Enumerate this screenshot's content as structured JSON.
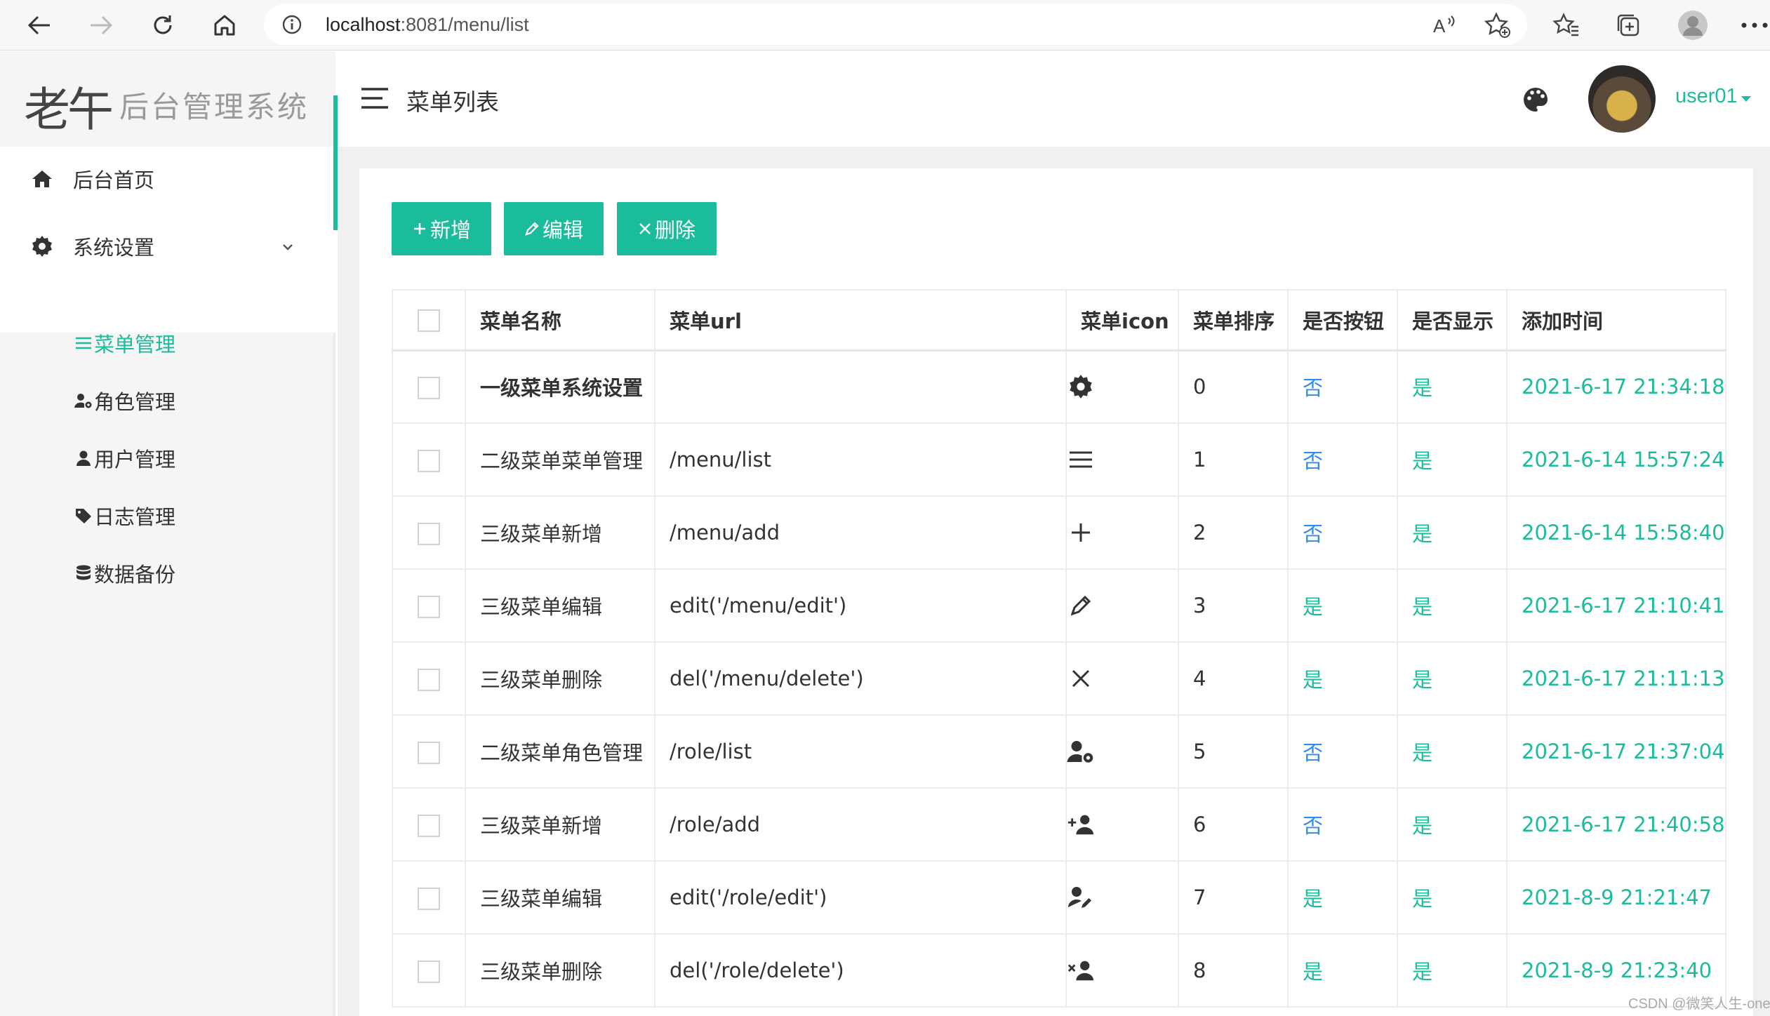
{
  "browser": {
    "url_host": "localhost",
    "url_rest": ":8081/menu/list"
  },
  "sidebar": {
    "logo_mark": "老午",
    "logo_text": "后台管理系统",
    "items": [
      {
        "label": "后台首页",
        "icon": "home-icon"
      },
      {
        "label": "系统设置",
        "icon": "gear-icon"
      }
    ],
    "subitems": [
      {
        "label": "菜单管理",
        "icon": "menu-icon",
        "active": true
      },
      {
        "label": "角色管理",
        "icon": "user-cog-icon"
      },
      {
        "label": "用户管理",
        "icon": "user-icon"
      },
      {
        "label": "日志管理",
        "icon": "tag-icon"
      },
      {
        "label": "数据备份",
        "icon": "database-icon"
      }
    ]
  },
  "header": {
    "title": "菜单列表",
    "user": "user01"
  },
  "toolbar": {
    "add_label": "新增",
    "edit_label": "编辑",
    "delete_label": "删除"
  },
  "table": {
    "columns": [
      "菜单名称",
      "菜单url",
      "菜单icon",
      "菜单排序",
      "是否按钮",
      "是否显示",
      "添加时间"
    ],
    "rows": [
      {
        "name": "一级菜单系统设置",
        "url": "",
        "icon": "gear-icon",
        "sort": "0",
        "is_button": "否",
        "is_show": "是",
        "time": "2021-6-17 21:34:18"
      },
      {
        "name": "二级菜单菜单管理",
        "url": "/menu/list",
        "icon": "menu-icon",
        "sort": "1",
        "is_button": "否",
        "is_show": "是",
        "time": "2021-6-14 15:57:24"
      },
      {
        "name": "三级菜单新增",
        "url": "/menu/add",
        "icon": "plus-icon",
        "sort": "2",
        "is_button": "否",
        "is_show": "是",
        "time": "2021-6-14 15:58:40"
      },
      {
        "name": "三级菜单编辑",
        "url": "edit('/menu/edit')",
        "icon": "pencil-icon",
        "sort": "3",
        "is_button": "是",
        "is_show": "是",
        "time": "2021-6-17 21:10:41"
      },
      {
        "name": "三级菜单删除",
        "url": "del('/menu/delete')",
        "icon": "close-icon",
        "sort": "4",
        "is_button": "是",
        "is_show": "是",
        "time": "2021-6-17 21:11:13"
      },
      {
        "name": "二级菜单角色管理",
        "url": "/role/list",
        "icon": "user-cog-icon",
        "sort": "5",
        "is_button": "否",
        "is_show": "是",
        "time": "2021-6-17 21:37:04"
      },
      {
        "name": "三级菜单新增",
        "url": "/role/add",
        "icon": "user-plus-icon",
        "sort": "6",
        "is_button": "否",
        "is_show": "是",
        "time": "2021-6-17 21:40:58"
      },
      {
        "name": "三级菜单编辑",
        "url": "edit('/role/edit')",
        "icon": "user-edit-icon",
        "sort": "7",
        "is_button": "是",
        "is_show": "是",
        "time": "2021-8-9 21:21:47"
      },
      {
        "name": "三级菜单删除",
        "url": "del('/role/delete')",
        "icon": "user-times-icon",
        "sort": "8",
        "is_button": "是",
        "is_show": "是",
        "time": "2021-8-9 21:23:40"
      }
    ]
  },
  "watermark": "CSDN @微笑人生-one",
  "colors": {
    "accent": "#1abc9c",
    "link_no": "#2d8cf0"
  }
}
